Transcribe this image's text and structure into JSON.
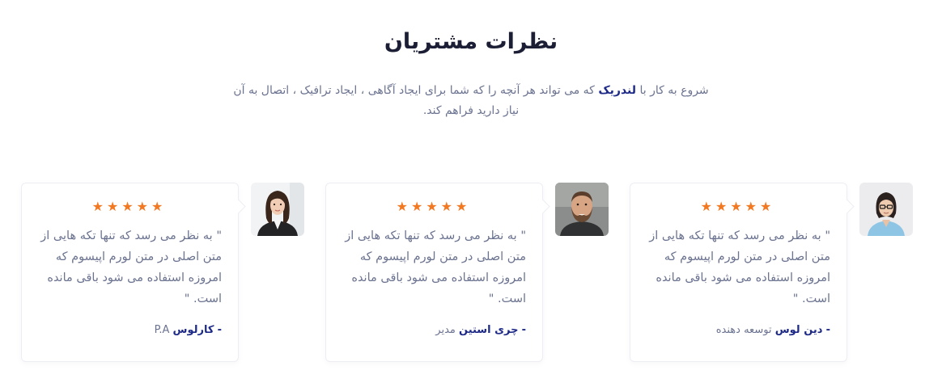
{
  "section": {
    "title": "نظرات مشتریان",
    "intro_before": "شروع به کار با",
    "intro_brand": "لندریک",
    "intro_after": "که می تواند هر آنچه را که شما برای ایجاد آگاهی ، ایجاد ترافیک ، اتصال به آن نیاز دارید فراهم کند."
  },
  "colors": {
    "accent_star": "#f27822",
    "brand_navy": "#1e2a87",
    "text_muted": "#6b7390",
    "heading": "#1b1e34"
  },
  "testimonials": [
    {
      "stars": "★★★★★",
      "rating": 5,
      "quote": "\" به نظر می رسد که تنها تکه هایی از متن اصلی در متن لورم اپیسوم که امروزه استفاده می شود باقی مانده است. \"",
      "dash": "-",
      "name": "دین لوس",
      "role": "توسعه دهنده",
      "avatar_icon": "avatar-woman-glasses"
    },
    {
      "stars": "★★★★★",
      "rating": 5,
      "quote": "\" به نظر می رسد که تنها تکه هایی از متن اصلی در متن لورم اپیسوم که امروزه استفاده می شود باقی مانده است. \"",
      "dash": "-",
      "name": "چری استین",
      "role": "مدیر",
      "avatar_icon": "avatar-man-beard"
    },
    {
      "stars": "★★★★★",
      "rating": 5,
      "quote": "\" به نظر می رسد که تنها تکه هایی از متن اصلی در متن لورم اپیسوم که امروزه استفاده می شود باقی مانده است. \"",
      "dash": "-",
      "name": "کارلوس",
      "role": "P.A",
      "avatar_icon": "avatar-woman-dark-hair"
    }
  ]
}
